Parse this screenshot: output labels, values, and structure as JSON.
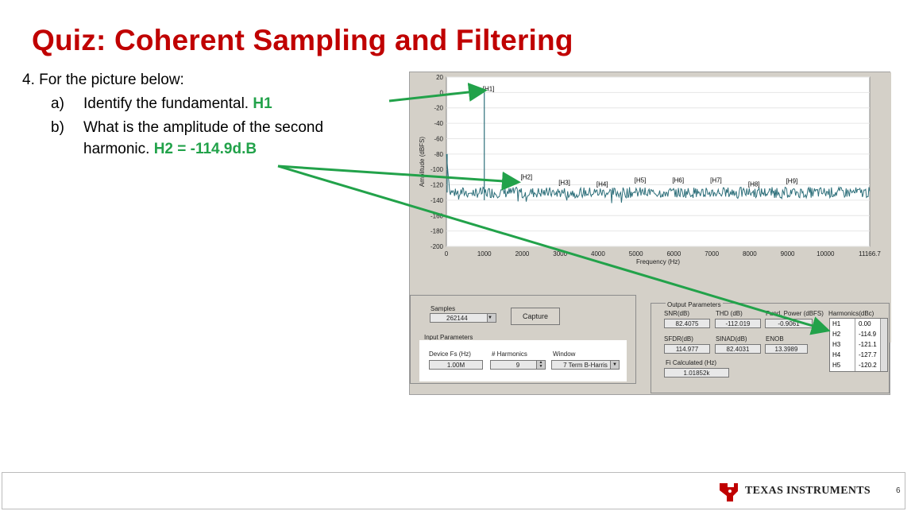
{
  "slide": {
    "title": "Quiz: Coherent Sampling and Filtering",
    "question": "4.  For the picture below:",
    "item_a_label": "a)",
    "item_a_text": "Identify the fundamental.",
    "item_a_answer": "H1",
    "item_b_label": "b)",
    "item_b_text": "What is the amplitude of the second",
    "item_b_text2": "harmonic.",
    "item_b_answer": "H2 = -114.9d.B",
    "page_number": "6",
    "brand": "Texas Instruments",
    "brand_display": "TEXAS INSTRUMENTS",
    "answer_color": "#22a24a",
    "title_color": "#c00000"
  },
  "chart_data": {
    "type": "line",
    "ylabel": "Amplitude (dBFS)",
    "xlabel": "Frequency (Hz)",
    "y_ticks": [
      "20",
      "0",
      "-20",
      "-40",
      "-60",
      "-80",
      "-100",
      "-120",
      "-140",
      "-160",
      "-180",
      "-200"
    ],
    "x_ticks": [
      "0",
      "1000",
      "2000",
      "3000",
      "4000",
      "5000",
      "6000",
      "7000",
      "8000",
      "9000",
      "10000",
      "11166.7"
    ],
    "ylim": [
      -200,
      20
    ],
    "xlim": [
      0,
      11166.7
    ],
    "noise_floor_approx": -130,
    "harmonic_markers": [
      {
        "label": "[H1]",
        "x": 1000,
        "y": 0
      },
      {
        "label": "[H2]",
        "x": 2000,
        "y": -115
      },
      {
        "label": "[H3]",
        "x": 3000,
        "y": -122
      },
      {
        "label": "[H4]",
        "x": 4000,
        "y": -124
      },
      {
        "label": "[H5]",
        "x": 5000,
        "y": -119
      },
      {
        "label": "[H6]",
        "x": 6000,
        "y": -119
      },
      {
        "label": "[H7]",
        "x": 7000,
        "y": -119
      },
      {
        "label": "[H8]",
        "x": 8000,
        "y": -124
      },
      {
        "label": "[H9]",
        "x": 9000,
        "y": -120
      }
    ]
  },
  "gui": {
    "samples_label": "Samples",
    "samples_value": "262144",
    "capture_label": "Capture",
    "input_params_label": "Input Parameters",
    "device_fs_label": "Device Fs (Hz)",
    "device_fs_value": "1.00M",
    "num_harmonics_label": "# Harmonics",
    "num_harmonics_value": "9",
    "window_label": "Window",
    "window_value": "7 Term B-Harris",
    "output_params_label": "Output Parameters",
    "snr_label": "SNR(dB)",
    "snr_value": "82.4075",
    "thd_label": "THD (dB)",
    "thd_value": "-112.019",
    "fund_power_label": "Fund. Power (dBFS)",
    "fund_power_value": "-0.9061",
    "sfdr_label": "SFDR(dB)",
    "sfdr_value": "114.977",
    "sinad_label": "SINAD(dB)",
    "sinad_value": "82.4031",
    "enob_label": "ENOB",
    "enob_value": "13.3989",
    "fi_calc_label": "Fi Calculated (Hz)",
    "fi_calc_value": "1.01852k",
    "harmonics_header": "Harmonics(dBc)",
    "harmonics": [
      {
        "name": "H1",
        "value": "0.00"
      },
      {
        "name": "H2",
        "value": "-114.9"
      },
      {
        "name": "H3",
        "value": "-121.1"
      },
      {
        "name": "H4",
        "value": "-127.7"
      },
      {
        "name": "H5",
        "value": "-120.2"
      }
    ]
  }
}
